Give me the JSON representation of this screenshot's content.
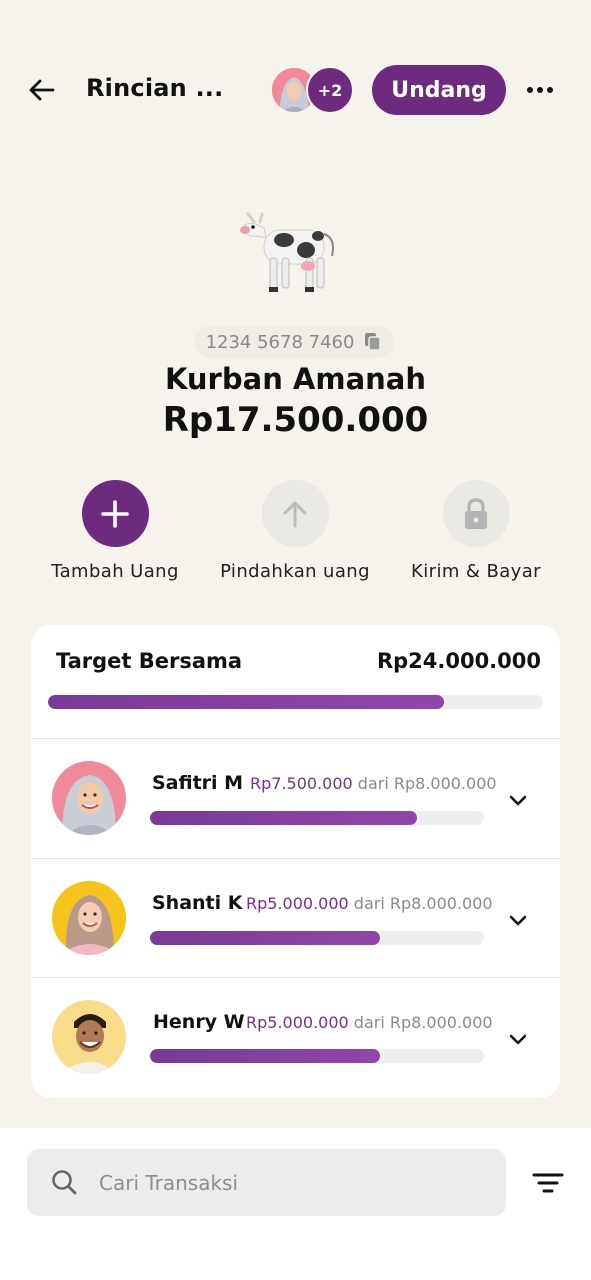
{
  "header": {
    "title": "Rincian ...",
    "extra_members": "+2",
    "invite_label": "Undang"
  },
  "pocket": {
    "emoji": "🐄",
    "account_number": "1234 5678 7460",
    "name": "Kurban Amanah",
    "balance": "Rp17.500.000"
  },
  "actions": [
    {
      "label": "Tambah Uang",
      "icon": "plus-icon",
      "enabled": true
    },
    {
      "label": "Pindahkan uang",
      "icon": "arrow-up-icon",
      "enabled": false
    },
    {
      "label": "Kirim & Bayar",
      "icon": "lock-icon",
      "enabled": false
    }
  ],
  "target": {
    "title": "Target Bersama",
    "amount": "Rp24.000.000",
    "progress": 0.8
  },
  "members": [
    {
      "name": "Safitri M",
      "current": "Rp7.500.000",
      "of_text": "dari Rp8.000.000",
      "progress": 0.8
    },
    {
      "name": "Shanti K",
      "current": "Rp5.000.000",
      "of_text": "dari Rp8.000.000",
      "progress": 0.69
    },
    {
      "name": "Henry W",
      "current": "Rp5.000.000",
      "of_text": "dari Rp8.000.000",
      "progress": 0.69
    }
  ],
  "search": {
    "placeholder": "Cari Transaksi"
  },
  "colors": {
    "brand": "#6e2a7e",
    "progress": "#8a40a2",
    "background": "#f5f3ec"
  }
}
